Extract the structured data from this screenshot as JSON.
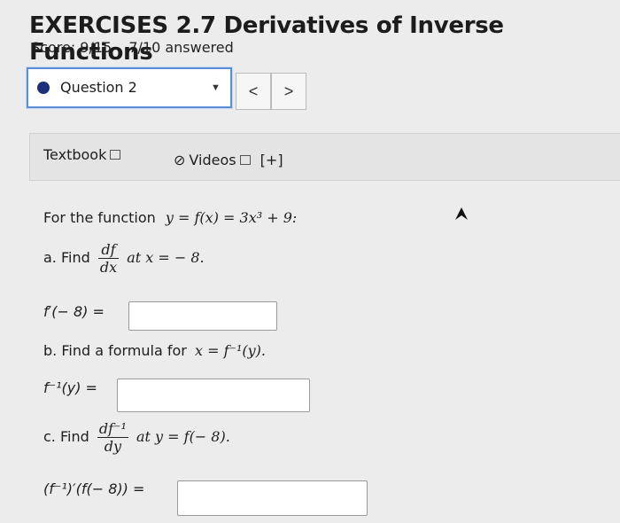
{
  "header": {
    "title": "EXERCISES 2.7 Derivatives of Inverse Functions",
    "score": "Score: 9/15",
    "answered": "7/10 answered"
  },
  "question_selector": {
    "label": "Question 2"
  },
  "nav": {
    "prev": "<",
    "next": ">"
  },
  "resources": {
    "textbook": "Textbook",
    "videos": "Videos",
    "expand": "[+]"
  },
  "problem": {
    "intro": "For the function",
    "function": "y = f(x) = 3x³ + 9:",
    "part_a": {
      "prefix": "a. Find",
      "frac_num": "df",
      "frac_den": "dx",
      "suffix": "at x = − 8.",
      "answer_label": "f′(− 8) ="
    },
    "part_b": {
      "prefix": "b. Find a formula for",
      "expr": "x = f⁻¹(y).",
      "answer_label": "f⁻¹(y) ="
    },
    "part_c": {
      "prefix": "c. Find",
      "frac_num": "df⁻¹",
      "frac_den": "dy",
      "suffix": "at y = f(− 8).",
      "answer_label": "(f⁻¹)′(f(− 8)) ="
    }
  },
  "answers": {
    "a": "",
    "b": "",
    "c": ""
  }
}
